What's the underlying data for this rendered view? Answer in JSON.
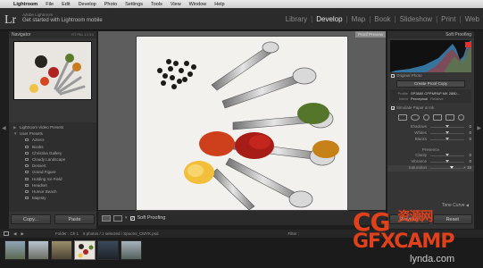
{
  "menubar": {
    "app": "Lightroom",
    "items": [
      "File",
      "Edit",
      "Develop",
      "Photo",
      "Settings",
      "Tools",
      "View",
      "Window",
      "Help"
    ]
  },
  "identity": {
    "logo": "Lr",
    "line1": "Adobe Lightroom",
    "line2": "Get started with Lightroom mobile"
  },
  "modules": [
    "Library",
    "Develop",
    "Map",
    "Book",
    "Slideshow",
    "Print",
    "Web"
  ],
  "active_module": "Develop",
  "left": {
    "navigator_title": "Navigator",
    "navigator_zoom": "FIT  FILL  1:1  3:1",
    "presets": [
      {
        "label": "Lightroom Video Presets",
        "sub": false
      },
      {
        "label": "User Presets",
        "sub": false
      },
      {
        "label": "Aztecs",
        "sub": true
      },
      {
        "label": "Books",
        "sub": true
      },
      {
        "label": "Christina Gallery",
        "sub": true
      },
      {
        "label": "Cloudy Landscape",
        "sub": true
      },
      {
        "label": "Dessert",
        "sub": true
      },
      {
        "label": "Grand Figure",
        "sub": true
      },
      {
        "label": "Holding Ice Field",
        "sub": true
      },
      {
        "label": "Headset",
        "sub": true
      },
      {
        "label": "Humor Beach",
        "sub": true
      },
      {
        "label": "Majesty",
        "sub": true
      }
    ],
    "copy_label": "Copy...",
    "paste_label": "Paste"
  },
  "center": {
    "proof_header": "Proof Preview",
    "soft_proofing_label": "Soft Proofing"
  },
  "right": {
    "title": "Soft Proofing",
    "original_photo": "Original Photo",
    "create_proof_copy": "Create Proof Copy",
    "profile_key": "Profile",
    "profile_value": "SP3880 CPPMPAP MK 2880...",
    "intent_key": "Intent",
    "intent_perceptual": "Perceptual",
    "intent_relative": "Relative",
    "simulate_paper": "Simulate Paper & Ink",
    "sliders_top": [
      {
        "label": "Shadows",
        "value": "0"
      },
      {
        "label": "Whites",
        "value": "0"
      },
      {
        "label": "Blacks",
        "value": "0"
      }
    ],
    "presence_title": "Presence",
    "sliders_presence": [
      {
        "label": "Clarity",
        "value": "0"
      },
      {
        "label": "Vibrance",
        "value": "0"
      },
      {
        "label": "Saturation",
        "value": "+ 15"
      }
    ],
    "tone_curve": "Tone Curve",
    "previous_label": "Previous",
    "reset_label": "Reset"
  },
  "filmstrip": {
    "source": "Folder : Ch 1",
    "info": "6 photos / 1 selected / Spoons_CMYK.psd",
    "filter": "Filter :"
  },
  "watermark": {
    "l1": "CG",
    "l1b": "资源网",
    "l2": "GFXCAMP",
    "l3": "lynda.com"
  },
  "colors": {
    "accent": "#e0401a",
    "panel_bg": "#353535",
    "app_bg": "#1e1e1e"
  }
}
